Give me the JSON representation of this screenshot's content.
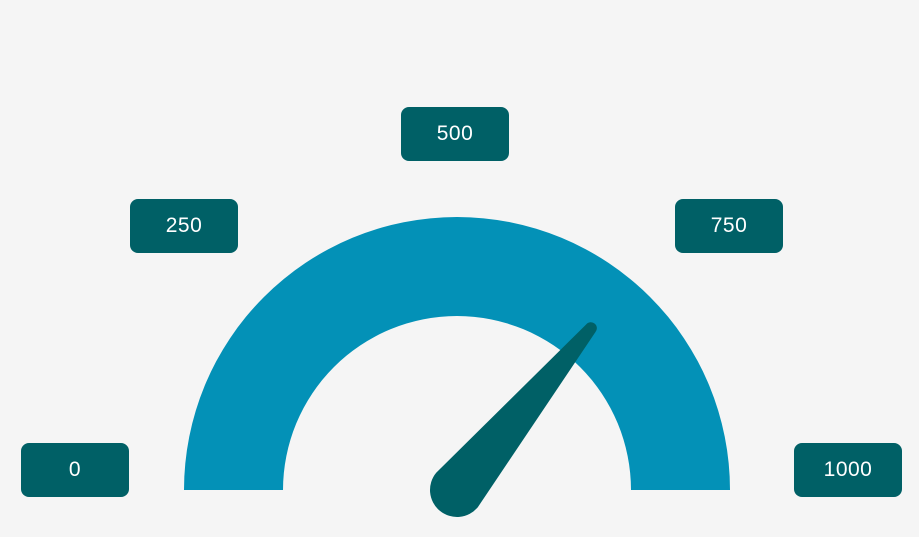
{
  "chart_data": {
    "type": "gauge",
    "min": 0,
    "max": 1000,
    "value": 720,
    "ticks": [
      {
        "label": "0",
        "value": 0
      },
      {
        "label": "250",
        "value": 250
      },
      {
        "label": "500",
        "value": 500
      },
      {
        "label": "750",
        "value": 750
      },
      {
        "label": "1000",
        "value": 1000
      }
    ]
  },
  "colors": {
    "background": "#f5f5f5",
    "arc": "#0391b7",
    "needle": "#006066",
    "tick_box": "#006066",
    "tick_text": "#ffffff"
  }
}
